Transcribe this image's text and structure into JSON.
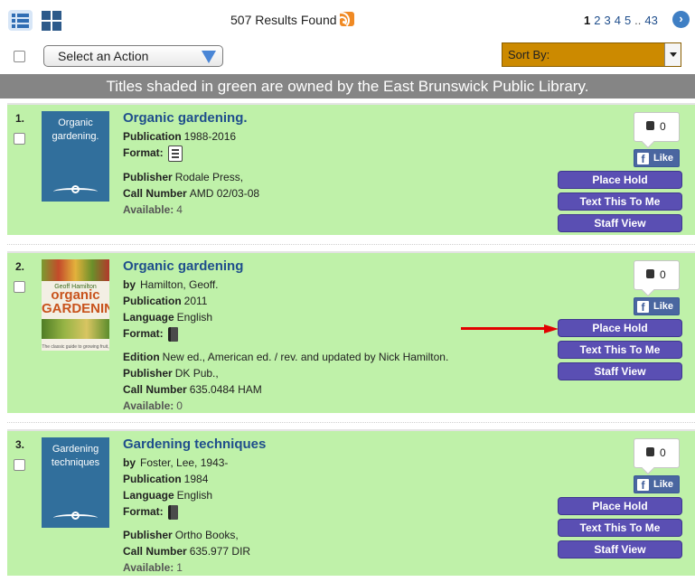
{
  "toolbar": {
    "results_text": "507 Results Found",
    "pages": [
      "1",
      "2",
      "3",
      "4",
      "5",
      "..",
      "43"
    ],
    "current_page": "1",
    "next_icon": "chevron-right-icon"
  },
  "controls": {
    "action_select": "Select an Action",
    "sort_by": "Sort By:"
  },
  "banner": "Titles shaded in green are owned by the East Brunswick Public Library.",
  "labels": {
    "by": "by",
    "publication": "Publication",
    "format": "Format:",
    "language": "Language",
    "edition": "Edition",
    "publisher": "Publisher",
    "call_number": "Call Number",
    "available": "Available:"
  },
  "social": {
    "like_count": "0",
    "like_label": "Like",
    "fb_letter": "f"
  },
  "buttons": {
    "place_hold": "Place Hold",
    "text_this": "Text This To Me",
    "staff_view": "Staff View"
  },
  "records": [
    {
      "number": "1.",
      "title": "Organic gardening.",
      "cover_title": "Organic gardening.",
      "publication": "1988-2016",
      "format_icon": "serial-icon",
      "publisher": "Rodale Press,",
      "call_number": "AMD 02/03-08",
      "available": "4"
    },
    {
      "number": "2.",
      "title": "Organic gardening",
      "cover_author": "Geoff Hamilton",
      "cover_big_title": "organic GARDENING",
      "cover_tagline": "The classic guide to growing fruit, flowers, and vegetables the natural way",
      "author": "Hamilton, Geoff.",
      "publication": "2011",
      "language": "English",
      "format_icon": "book-icon",
      "edition": "New ed., American ed. / rev. and updated by Nick Hamilton.",
      "publisher": "DK Pub.,",
      "call_number": "635.0484 HAM",
      "available": "0"
    },
    {
      "number": "3.",
      "title": "Gardening techniques",
      "cover_title": "Gardening techniques",
      "author": "Foster, Lee, 1943-",
      "publication": "1984",
      "language": "English",
      "format_icon": "book-icon",
      "publisher": "Ortho Books,",
      "call_number": "635.977 DIR",
      "available": "1"
    }
  ],
  "colors": {
    "record_bg": "#bff1a9",
    "action_button": "#5a4fb3",
    "link": "#1f4e8c",
    "sort_bg": "#cc8a00",
    "banner_bg": "#858585",
    "annotation_arrow": "#e20000"
  }
}
